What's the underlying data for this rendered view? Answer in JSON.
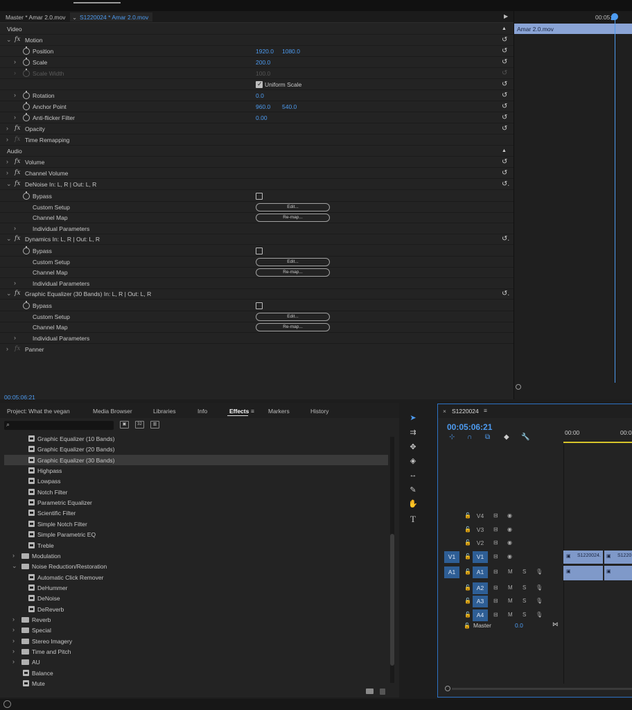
{
  "effect_controls": {
    "source_label": "Master * Amar 2.0.mov",
    "sequence_label": "S1220024 * Amar 2.0.mov",
    "video_header": "Video",
    "audio_header": "Audio",
    "motion": {
      "name": "Motion",
      "position": {
        "label": "Position",
        "x": "1920.0",
        "y": "1080.0"
      },
      "scale": {
        "label": "Scale",
        "value": "200.0"
      },
      "scale_width": {
        "label": "Scale Width",
        "value": "100.0"
      },
      "uniform_scale": {
        "label": "Uniform Scale",
        "checked": true
      },
      "rotation": {
        "label": "Rotation",
        "value": "0.0"
      },
      "anchor_point": {
        "label": "Anchor Point",
        "x": "960.0",
        "y": "540.0"
      },
      "anti_flicker": {
        "label": "Anti-flicker Filter",
        "value": "0.00"
      }
    },
    "opacity": "Opacity",
    "time_remapping": "Time Remapping",
    "volume": "Volume",
    "channel_volume": "Channel Volume",
    "denoise": {
      "name": "DeNoise In: L, R | Out: L, R"
    },
    "dynamics": {
      "name": "Dynamics In: L, R | Out: L, R"
    },
    "graphic_eq": {
      "name": "Graphic Equalizer (30 Bands) In: L, R | Out: L, R"
    },
    "bypass": "Bypass",
    "custom_setup": "Custom Setup",
    "channel_map": "Channel Map",
    "individual_parameters": "Individual Parameters",
    "edit_button": "Edit...",
    "remap_button": "Re-map...",
    "panner": "Panner",
    "timecode": "00:05:06:21",
    "timeline_timecode": "00:05:",
    "clip_name": "Amar 2.0.mov"
  },
  "effects_panel": {
    "tabs": [
      "Project: What the vegan",
      "Media Browser",
      "Libraries",
      "Info",
      "Effects",
      "Markers",
      "History"
    ],
    "active_tab": "Effects",
    "search_placeholder": "",
    "items": [
      {
        "label": "Graphic Equalizer (10 Bands)",
        "kind": "preset"
      },
      {
        "label": "Graphic Equalizer (20 Bands)",
        "kind": "preset"
      },
      {
        "label": "Graphic Equalizer (30 Bands)",
        "kind": "preset",
        "selected": true
      },
      {
        "label": "Highpass",
        "kind": "preset"
      },
      {
        "label": "Lowpass",
        "kind": "preset"
      },
      {
        "label": "Notch Filter",
        "kind": "preset"
      },
      {
        "label": "Parametric Equalizer",
        "kind": "preset"
      },
      {
        "label": "Scientific Filter",
        "kind": "preset"
      },
      {
        "label": "Simple Notch Filter",
        "kind": "preset"
      },
      {
        "label": "Simple Parametric EQ",
        "kind": "preset"
      },
      {
        "label": "Treble",
        "kind": "preset"
      },
      {
        "label": "Modulation",
        "kind": "folder"
      },
      {
        "label": "Noise Reduction/Restoration",
        "kind": "folder-open"
      },
      {
        "label": "Automatic Click Remover",
        "kind": "preset"
      },
      {
        "label": "DeHummer",
        "kind": "preset"
      },
      {
        "label": "DeNoise",
        "kind": "preset"
      },
      {
        "label": "DeReverb",
        "kind": "preset"
      },
      {
        "label": "Reverb",
        "kind": "folder"
      },
      {
        "label": "Special",
        "kind": "folder"
      },
      {
        "label": "Stereo Imagery",
        "kind": "folder"
      },
      {
        "label": "Time and Pitch",
        "kind": "folder"
      },
      {
        "label": "AU",
        "kind": "folder"
      },
      {
        "label": "Balance",
        "kind": "preset-top"
      },
      {
        "label": "Mute",
        "kind": "preset-top"
      }
    ]
  },
  "sequence": {
    "name": "S1220024",
    "timecode": "00:05:06:21",
    "ruler": [
      "00:00",
      "00:0"
    ],
    "video_tracks": [
      "V4",
      "V3",
      "V2",
      "V1"
    ],
    "audio_tracks": [
      "A1",
      "A2",
      "A3",
      "A4"
    ],
    "target_v": "V1",
    "target_a": "A1",
    "clip_label": "S1220024.",
    "clip_label2": "S1220",
    "mute": "M",
    "solo": "S",
    "master_label": "Master",
    "master_value": "0.0"
  }
}
